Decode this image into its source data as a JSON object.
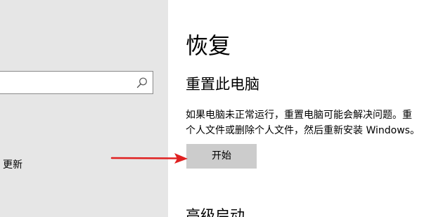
{
  "sidebar": {
    "search": {
      "value": "",
      "placeholder": ""
    },
    "items": [
      {
        "label": "更新"
      }
    ]
  },
  "main": {
    "title": "恢复",
    "reset_section": {
      "title": "重置此电脑",
      "description_lines": [
        "如果电脑未正常运行，重置电脑可能会解决问题。重",
        "个人文件或删除个人文件，然后重新安装 Windows。"
      ],
      "button_label": "开始"
    },
    "advanced_section": {
      "title": "高级启动"
    }
  },
  "colors": {
    "sidebar_bg": "#e6e6e6",
    "button_bg": "#cccccc",
    "annotation_arrow": "#e02020"
  }
}
